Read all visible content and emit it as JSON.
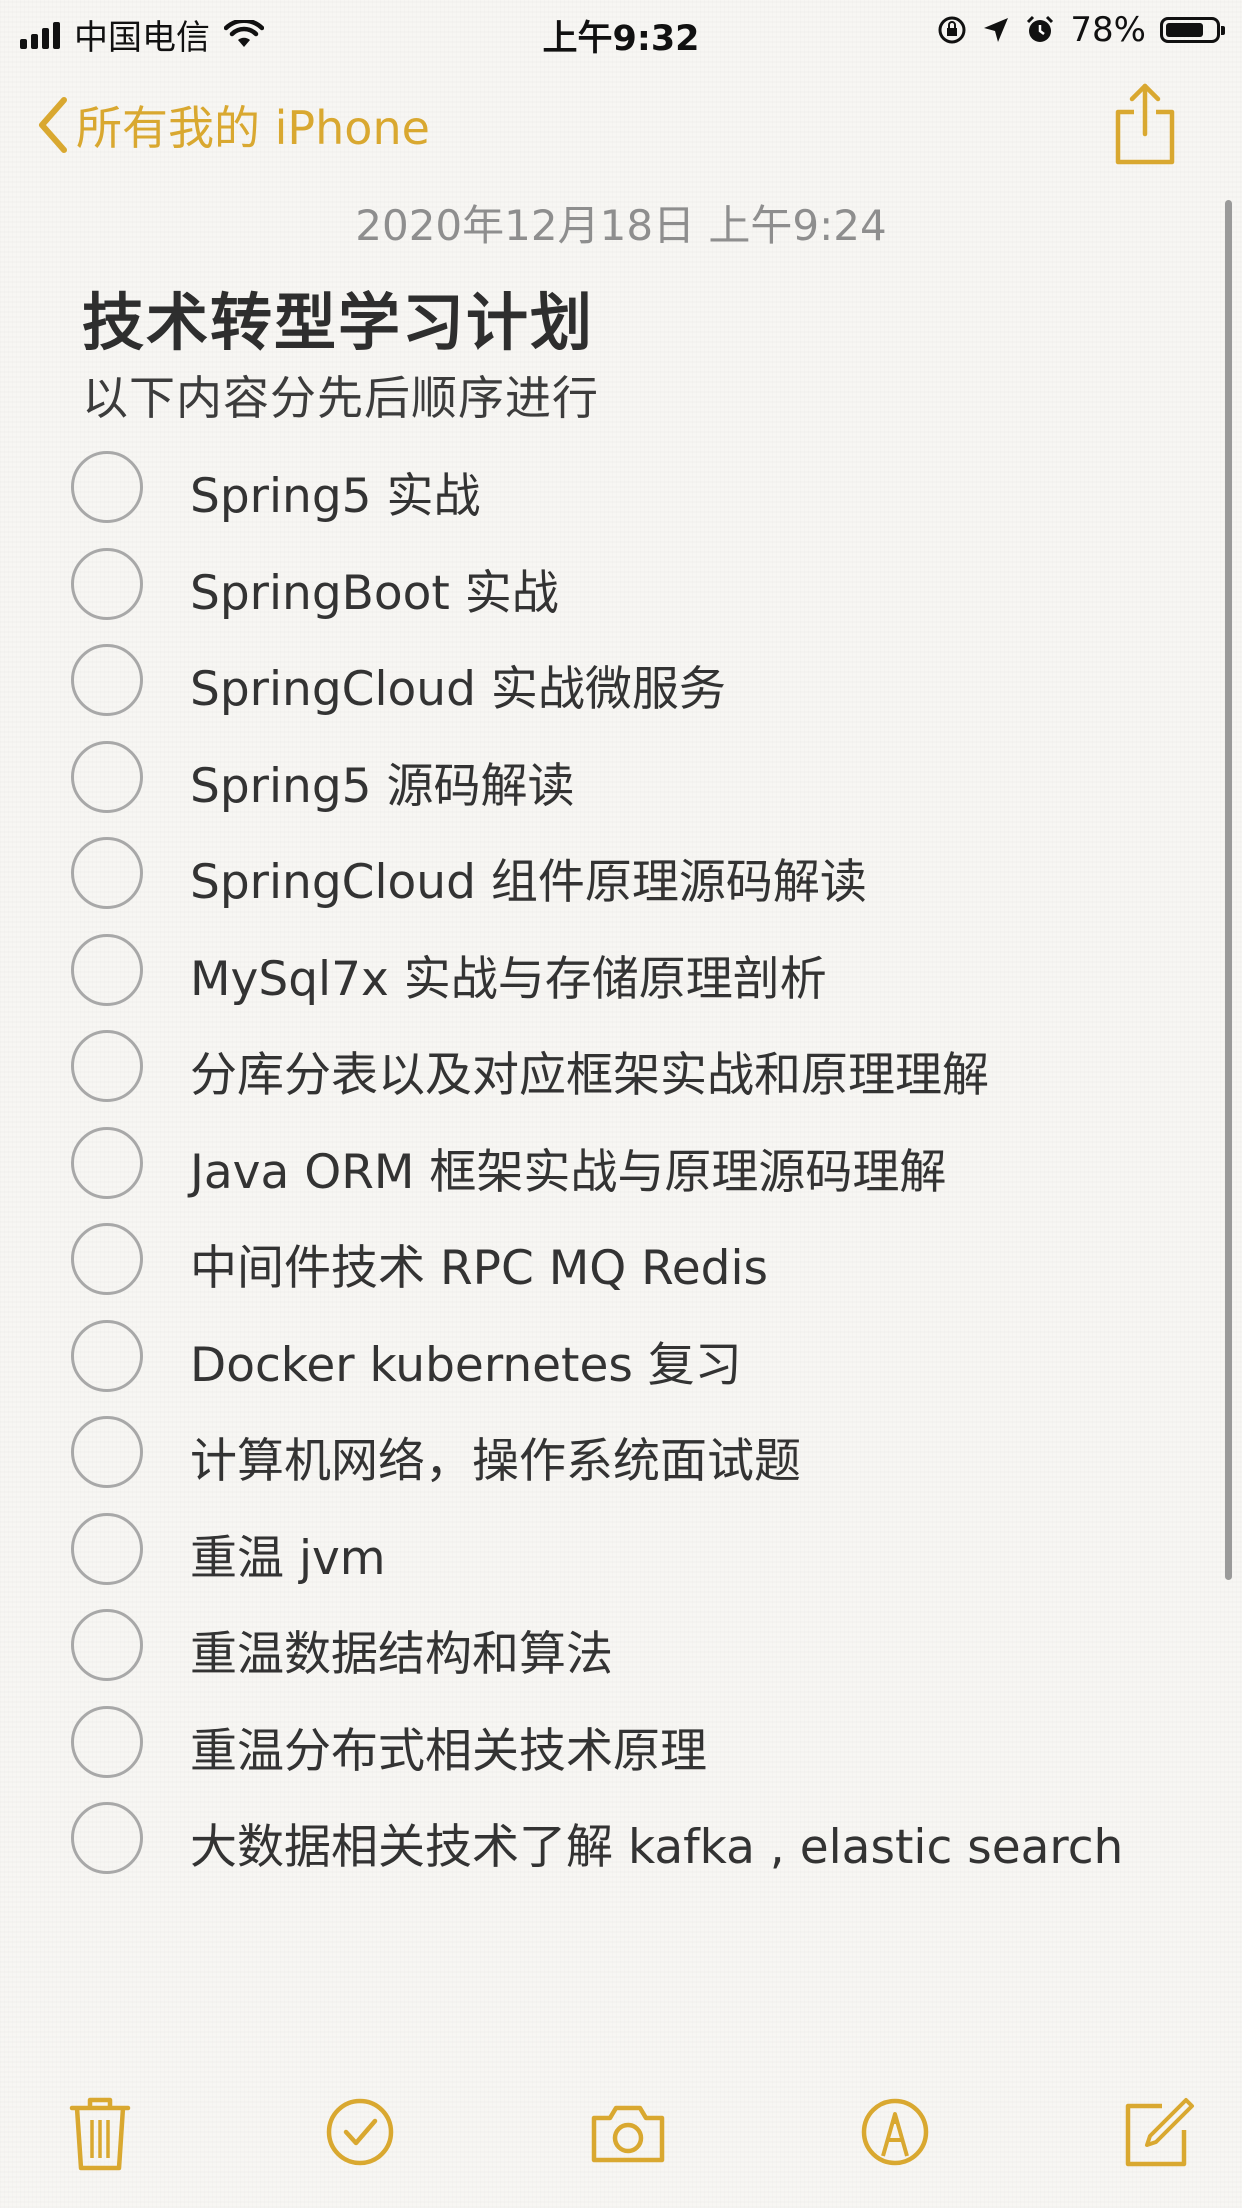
{
  "status_bar": {
    "carrier": "中国电信",
    "time": "上午9:32",
    "battery_percent": "78%",
    "battery_level": 0.78,
    "icons": [
      "signal-icon",
      "wifi-icon",
      "rotation-lock-icon",
      "location-icon",
      "alarm-icon",
      "battery-icon"
    ]
  },
  "nav": {
    "back_label": "所有我的 iPhone",
    "back_icon": "chevron-left-icon",
    "share_icon": "share-icon"
  },
  "note": {
    "date": "2020年12月18日 上午9:24",
    "title": "技术转型学习计划",
    "subtitle": "以下内容分先后顺序进行",
    "checklist": [
      {
        "text": "Spring5 实战",
        "checked": false
      },
      {
        "text": "SpringBoot 实战",
        "checked": false
      },
      {
        "text": "SpringCloud 实战微服务",
        "checked": false
      },
      {
        "text": "Spring5 源码解读",
        "checked": false
      },
      {
        "text": "SpringCloud 组件原理源码解读",
        "checked": false
      },
      {
        "text": "MySql7x 实战与存储原理剖析",
        "checked": false
      },
      {
        "text": "分库分表以及对应框架实战和原理理解",
        "checked": false
      },
      {
        "text": "Java ORM 框架实战与原理源码理解",
        "checked": false
      },
      {
        "text": "中间件技术 RPC MQ Redis",
        "checked": false
      },
      {
        "text": "Docker kubernetes 复习",
        "checked": false
      },
      {
        "text": "计算机网络，操作系统面试题",
        "checked": false
      },
      {
        "text": "重温 jvm",
        "checked": false
      },
      {
        "text": "重温数据结构和算法",
        "checked": false
      },
      {
        "text": "重温分布式相关技术原理",
        "checked": false
      },
      {
        "text": "大数据相关技术了解 kafka , elastic search",
        "checked": false
      }
    ]
  },
  "toolbar": {
    "items": [
      "trash-icon",
      "checklist-icon",
      "camera-icon",
      "markup-icon",
      "compose-icon"
    ]
  },
  "colors": {
    "accent": "#d9a830",
    "text": "#333333",
    "date": "#8e8e8e",
    "circle": "#a8a8a8",
    "background": "#f7f6f3"
  }
}
